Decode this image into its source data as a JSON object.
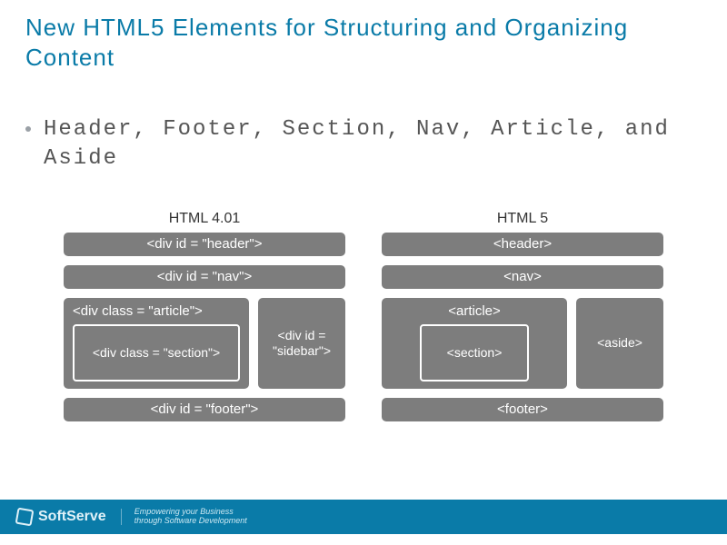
{
  "title": "New HTML5 Elements for Structuring and Organizing Content",
  "bullet": "Header, Footer, Section, Nav, Article, and Aside",
  "diagram": {
    "left": {
      "heading": "HTML 4.01",
      "header": "<div id = \"header\">",
      "nav": "<div id = \"nav\">",
      "article": "<div class = \"article\">",
      "section": "<div class = \"section\">",
      "sidebar": "<div id = \"sidebar\">",
      "footer": "<div id = \"footer\">"
    },
    "right": {
      "heading": "HTML 5",
      "header": "<header>",
      "nav": "<nav>",
      "article": "<article>",
      "section": "<section>",
      "aside": "<aside>",
      "footer": "<footer>"
    }
  },
  "footer": {
    "brand": "SoftServe",
    "tagline1": "Empowering your Business",
    "tagline2": "through Software Development"
  }
}
